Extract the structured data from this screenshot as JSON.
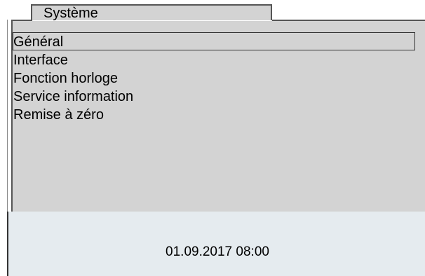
{
  "tab": {
    "title": "Système"
  },
  "menu": {
    "items": [
      {
        "label": "Général",
        "selected": true
      },
      {
        "label": "Interface",
        "selected": false
      },
      {
        "label": "Fonction horloge",
        "selected": false
      },
      {
        "label": "Service information",
        "selected": false
      },
      {
        "label": "Remise à zéro",
        "selected": false
      }
    ]
  },
  "status": {
    "datetime": "01.09.2017 08:00"
  },
  "colors": {
    "panel_bg": "#d3d3d3",
    "footer_bg": "#e5ebef",
    "frame": "#555555"
  }
}
